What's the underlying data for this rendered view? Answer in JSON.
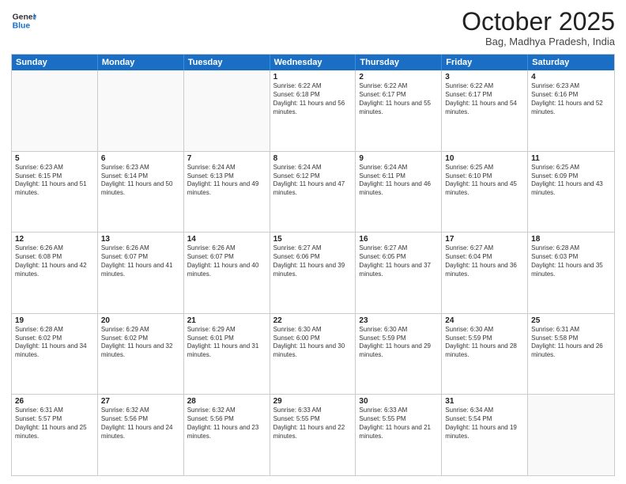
{
  "logo": {
    "line1": "General",
    "line2": "Blue"
  },
  "header": {
    "month": "October 2025",
    "location": "Bag, Madhya Pradesh, India"
  },
  "weekdays": [
    "Sunday",
    "Monday",
    "Tuesday",
    "Wednesday",
    "Thursday",
    "Friday",
    "Saturday"
  ],
  "rows": [
    [
      {
        "day": "",
        "sunrise": "",
        "sunset": "",
        "daylight": ""
      },
      {
        "day": "",
        "sunrise": "",
        "sunset": "",
        "daylight": ""
      },
      {
        "day": "",
        "sunrise": "",
        "sunset": "",
        "daylight": ""
      },
      {
        "day": "1",
        "sunrise": "Sunrise: 6:22 AM",
        "sunset": "Sunset: 6:18 PM",
        "daylight": "Daylight: 11 hours and 56 minutes."
      },
      {
        "day": "2",
        "sunrise": "Sunrise: 6:22 AM",
        "sunset": "Sunset: 6:17 PM",
        "daylight": "Daylight: 11 hours and 55 minutes."
      },
      {
        "day": "3",
        "sunrise": "Sunrise: 6:22 AM",
        "sunset": "Sunset: 6:17 PM",
        "daylight": "Daylight: 11 hours and 54 minutes."
      },
      {
        "day": "4",
        "sunrise": "Sunrise: 6:23 AM",
        "sunset": "Sunset: 6:16 PM",
        "daylight": "Daylight: 11 hours and 52 minutes."
      }
    ],
    [
      {
        "day": "5",
        "sunrise": "Sunrise: 6:23 AM",
        "sunset": "Sunset: 6:15 PM",
        "daylight": "Daylight: 11 hours and 51 minutes."
      },
      {
        "day": "6",
        "sunrise": "Sunrise: 6:23 AM",
        "sunset": "Sunset: 6:14 PM",
        "daylight": "Daylight: 11 hours and 50 minutes."
      },
      {
        "day": "7",
        "sunrise": "Sunrise: 6:24 AM",
        "sunset": "Sunset: 6:13 PM",
        "daylight": "Daylight: 11 hours and 49 minutes."
      },
      {
        "day": "8",
        "sunrise": "Sunrise: 6:24 AM",
        "sunset": "Sunset: 6:12 PM",
        "daylight": "Daylight: 11 hours and 47 minutes."
      },
      {
        "day": "9",
        "sunrise": "Sunrise: 6:24 AM",
        "sunset": "Sunset: 6:11 PM",
        "daylight": "Daylight: 11 hours and 46 minutes."
      },
      {
        "day": "10",
        "sunrise": "Sunrise: 6:25 AM",
        "sunset": "Sunset: 6:10 PM",
        "daylight": "Daylight: 11 hours and 45 minutes."
      },
      {
        "day": "11",
        "sunrise": "Sunrise: 6:25 AM",
        "sunset": "Sunset: 6:09 PM",
        "daylight": "Daylight: 11 hours and 43 minutes."
      }
    ],
    [
      {
        "day": "12",
        "sunrise": "Sunrise: 6:26 AM",
        "sunset": "Sunset: 6:08 PM",
        "daylight": "Daylight: 11 hours and 42 minutes."
      },
      {
        "day": "13",
        "sunrise": "Sunrise: 6:26 AM",
        "sunset": "Sunset: 6:07 PM",
        "daylight": "Daylight: 11 hours and 41 minutes."
      },
      {
        "day": "14",
        "sunrise": "Sunrise: 6:26 AM",
        "sunset": "Sunset: 6:07 PM",
        "daylight": "Daylight: 11 hours and 40 minutes."
      },
      {
        "day": "15",
        "sunrise": "Sunrise: 6:27 AM",
        "sunset": "Sunset: 6:06 PM",
        "daylight": "Daylight: 11 hours and 39 minutes."
      },
      {
        "day": "16",
        "sunrise": "Sunrise: 6:27 AM",
        "sunset": "Sunset: 6:05 PM",
        "daylight": "Daylight: 11 hours and 37 minutes."
      },
      {
        "day": "17",
        "sunrise": "Sunrise: 6:27 AM",
        "sunset": "Sunset: 6:04 PM",
        "daylight": "Daylight: 11 hours and 36 minutes."
      },
      {
        "day": "18",
        "sunrise": "Sunrise: 6:28 AM",
        "sunset": "Sunset: 6:03 PM",
        "daylight": "Daylight: 11 hours and 35 minutes."
      }
    ],
    [
      {
        "day": "19",
        "sunrise": "Sunrise: 6:28 AM",
        "sunset": "Sunset: 6:02 PM",
        "daylight": "Daylight: 11 hours and 34 minutes."
      },
      {
        "day": "20",
        "sunrise": "Sunrise: 6:29 AM",
        "sunset": "Sunset: 6:02 PM",
        "daylight": "Daylight: 11 hours and 32 minutes."
      },
      {
        "day": "21",
        "sunrise": "Sunrise: 6:29 AM",
        "sunset": "Sunset: 6:01 PM",
        "daylight": "Daylight: 11 hours and 31 minutes."
      },
      {
        "day": "22",
        "sunrise": "Sunrise: 6:30 AM",
        "sunset": "Sunset: 6:00 PM",
        "daylight": "Daylight: 11 hours and 30 minutes."
      },
      {
        "day": "23",
        "sunrise": "Sunrise: 6:30 AM",
        "sunset": "Sunset: 5:59 PM",
        "daylight": "Daylight: 11 hours and 29 minutes."
      },
      {
        "day": "24",
        "sunrise": "Sunrise: 6:30 AM",
        "sunset": "Sunset: 5:59 PM",
        "daylight": "Daylight: 11 hours and 28 minutes."
      },
      {
        "day": "25",
        "sunrise": "Sunrise: 6:31 AM",
        "sunset": "Sunset: 5:58 PM",
        "daylight": "Daylight: 11 hours and 26 minutes."
      }
    ],
    [
      {
        "day": "26",
        "sunrise": "Sunrise: 6:31 AM",
        "sunset": "Sunset: 5:57 PM",
        "daylight": "Daylight: 11 hours and 25 minutes."
      },
      {
        "day": "27",
        "sunrise": "Sunrise: 6:32 AM",
        "sunset": "Sunset: 5:56 PM",
        "daylight": "Daylight: 11 hours and 24 minutes."
      },
      {
        "day": "28",
        "sunrise": "Sunrise: 6:32 AM",
        "sunset": "Sunset: 5:56 PM",
        "daylight": "Daylight: 11 hours and 23 minutes."
      },
      {
        "day": "29",
        "sunrise": "Sunrise: 6:33 AM",
        "sunset": "Sunset: 5:55 PM",
        "daylight": "Daylight: 11 hours and 22 minutes."
      },
      {
        "day": "30",
        "sunrise": "Sunrise: 6:33 AM",
        "sunset": "Sunset: 5:55 PM",
        "daylight": "Daylight: 11 hours and 21 minutes."
      },
      {
        "day": "31",
        "sunrise": "Sunrise: 6:34 AM",
        "sunset": "Sunset: 5:54 PM",
        "daylight": "Daylight: 11 hours and 19 minutes."
      },
      {
        "day": "",
        "sunrise": "",
        "sunset": "",
        "daylight": ""
      }
    ]
  ]
}
